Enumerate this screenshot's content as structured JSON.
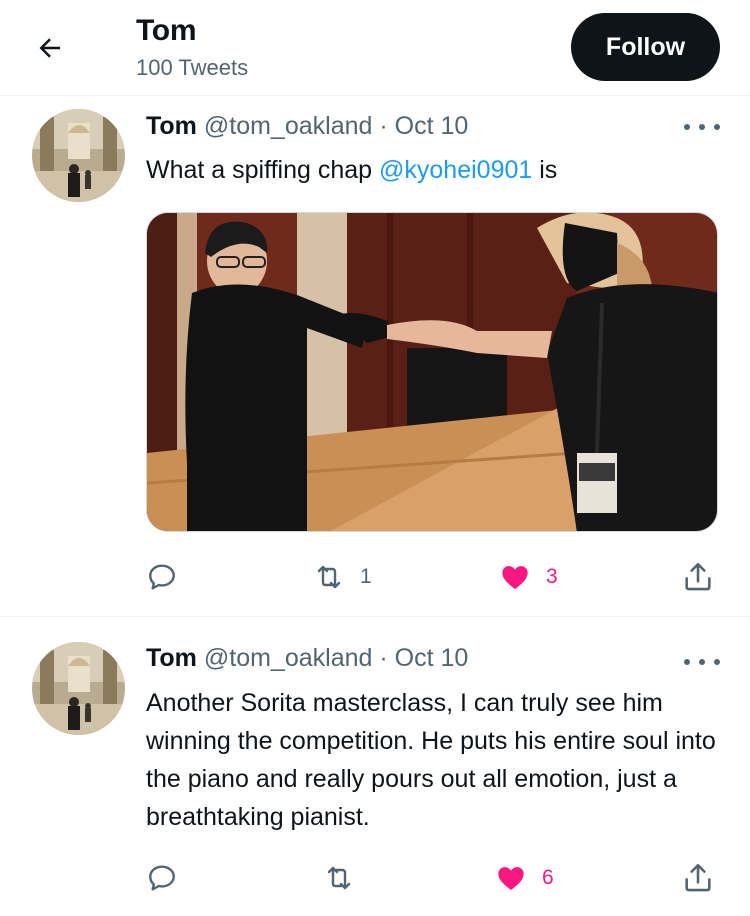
{
  "header": {
    "title": "Tom",
    "subtitle": "100 Tweets",
    "follow_label": "Follow"
  },
  "tweets": [
    {
      "name": "Tom",
      "handle": "@tom_oakland",
      "separator": "·",
      "date": "Oct 10",
      "text_before": "What a spiffing chap ",
      "mention": "@kyohei0901",
      "text_after": " is",
      "retweets": "1",
      "likes": "3"
    },
    {
      "name": "Tom",
      "handle": "@tom_oakland",
      "separator": "·",
      "date": "Oct 10",
      "text": "Another Sorita masterclass, I can truly see him winning the competition. He puts his entire soul into the piano and really pours out all emotion, just a breathtaking pianist.",
      "retweets": "",
      "likes": "6"
    }
  ],
  "colors": {
    "accent": "#1d9bf0",
    "like": "#f91880",
    "muted": "#536471",
    "text": "#0f1419"
  },
  "icons": [
    "back-arrow-icon",
    "more-icon",
    "reply-icon",
    "retweet-icon",
    "heart-icon",
    "share-icon"
  ]
}
